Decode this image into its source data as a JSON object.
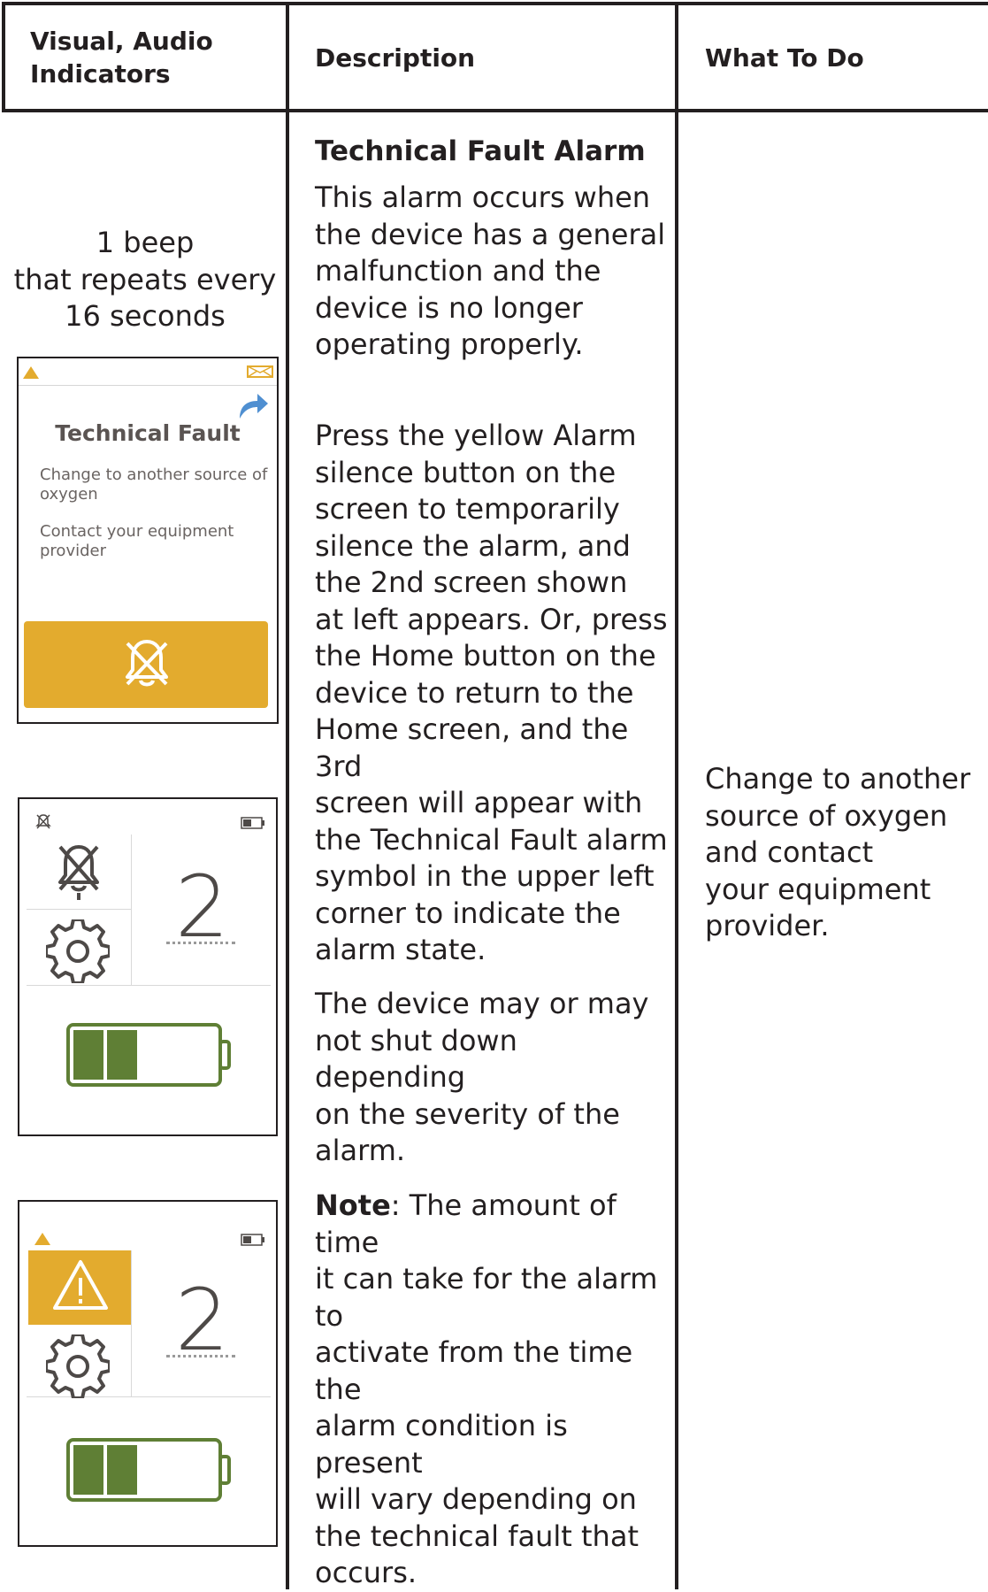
{
  "table": {
    "headers": {
      "col1": "Visual, Audio Indicators",
      "col2": "Description",
      "col3": "What To Do"
    },
    "audio_indicator": "1 beep\nthat repeats every\n16 seconds",
    "description": {
      "title": "Technical Fault Alarm",
      "p1": "This alarm occurs when\nthe device has a general\nmalfunction and the\ndevice is no longer\noperating properly.",
      "p2": "Press the yellow Alarm\nsilence button on the\nscreen to temporarily\nsilence the alarm, and\nthe 2nd screen shown\nat left appears. Or, press\nthe Home button on the\ndevice to return to the\nHome screen, and the 3rd\nscreen will appear with\nthe Technical Fault alarm\nsymbol in the upper left\ncorner to indicate the\nalarm state.",
      "p3": "The device may or may\nnot shut down depending\non the severity of the\nalarm.",
      "note_label": "Note",
      "note_text": ": The amount of time\nit can take for the alarm to\nactivate from the time the\nalarm condition is present\nwill vary depending on\nthe technical fault that\noccurs."
    },
    "what_to_do": "Change to another\nsource of oxygen\nand contact\nyour equipment\nprovider."
  },
  "screens": {
    "screen1": {
      "title": "Technical Fault",
      "message1": "Change to another source of oxygen",
      "message2": "Contact your equipment provider",
      "button_icon": "alarm-silence-icon"
    },
    "screen2": {
      "flow_value": "2",
      "battery_level": 0.45
    },
    "screen3": {
      "flow_value": "2",
      "battery_level": 0.45
    }
  },
  "colors": {
    "alarm_yellow": "#e3ab2e",
    "battery_green": "#5f7f35",
    "line": "#231f20"
  }
}
